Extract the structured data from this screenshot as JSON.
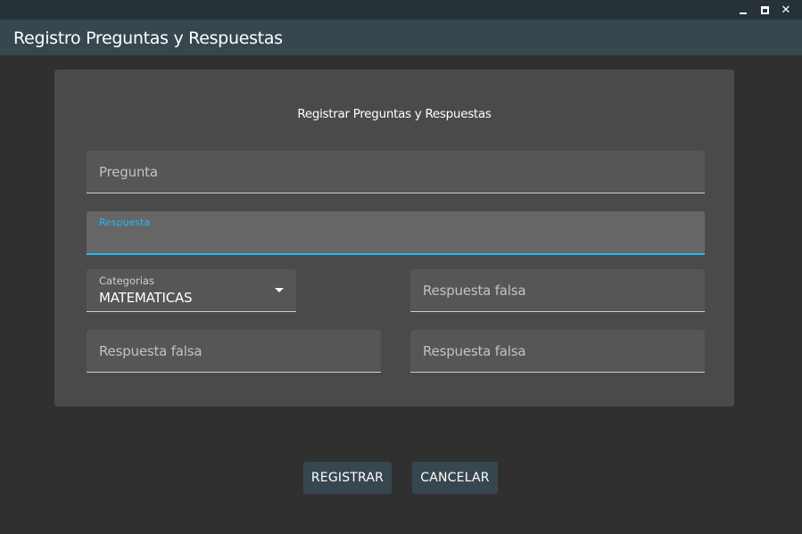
{
  "window": {
    "controls": {
      "minimize": "minimize-icon",
      "maximize": "maximize-icon",
      "close": "close-icon"
    }
  },
  "appbar": {
    "title": "Registro Preguntas y Respuestas"
  },
  "form": {
    "heading": "Registrar Preguntas y Respuestas",
    "pregunta": {
      "placeholder": "Pregunta",
      "value": ""
    },
    "respuesta": {
      "label": "Respuesta",
      "value": ""
    },
    "categorias": {
      "label": "Categorias",
      "selected": "MATEMATICAS"
    },
    "respuesta_falsa_1": {
      "placeholder": "Respuesta falsa",
      "value": ""
    },
    "respuesta_falsa_2": {
      "placeholder": "Respuesta falsa",
      "value": ""
    },
    "respuesta_falsa_3": {
      "placeholder": "Respuesta falsa",
      "value": ""
    }
  },
  "actions": {
    "register_label": "REGISTRAR",
    "cancel_label": "CANCELAR"
  },
  "colors": {
    "background": "#303030",
    "titlebar": "#263238",
    "appbar": "#37474f",
    "card": "#4a4a4a",
    "field": "#565656",
    "accent": "#29b6f6",
    "button": "#37474f"
  }
}
